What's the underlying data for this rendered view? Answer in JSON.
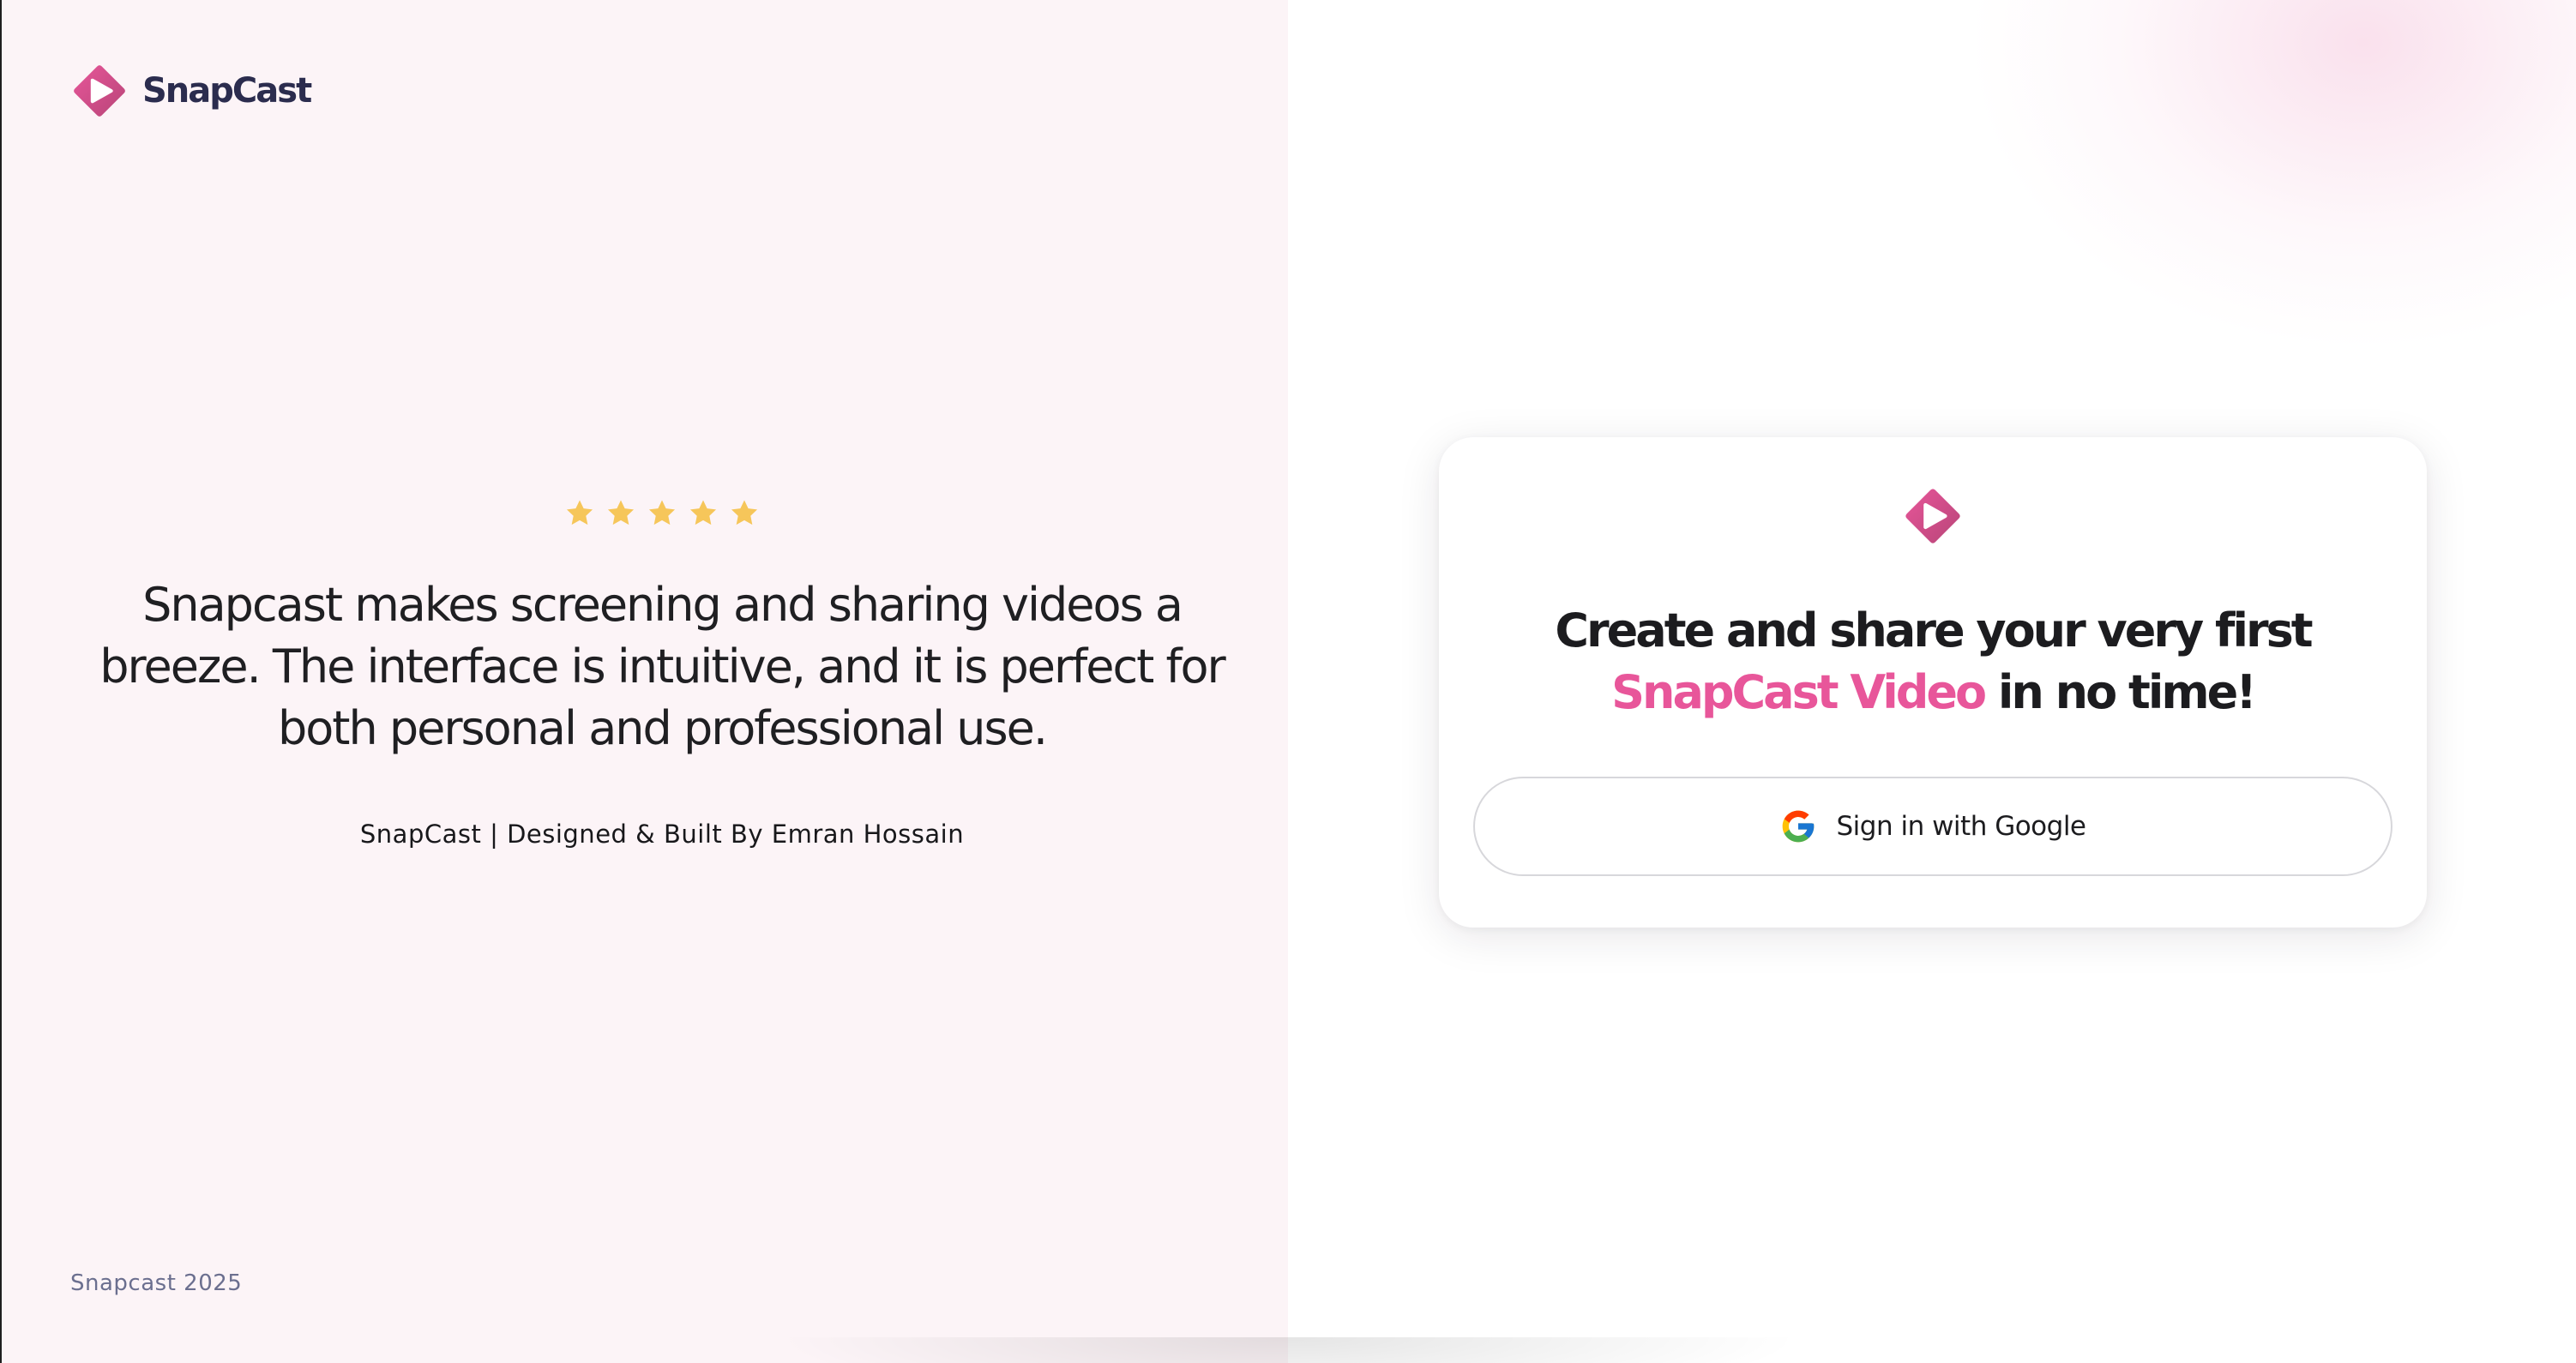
{
  "brand": {
    "name": "SnapCast",
    "logo_icon": "snapcast-play-logo-icon",
    "color_dark": "#c04a7e",
    "color_light": "#e8569a"
  },
  "testimonial": {
    "rating": 5,
    "rating_max": 5,
    "star_icon": "star-icon",
    "star_color": "#f6c65a",
    "quote": "Snapcast makes screening and sharing videos a breeze. The interface is intuitive, and it is perfect for both personal and professional use.",
    "credit": "SnapCast | Designed & Built By Emran Hossain"
  },
  "footer": {
    "copyright": "Snapcast 2025"
  },
  "signin_card": {
    "title_part1": "Create and share your very first ",
    "title_highlight": "SnapCast Video",
    "title_part2": " in no time!",
    "accent_color": "#e8569a",
    "google_button": {
      "label": "Sign in with Google",
      "icon": "google-g-icon"
    }
  }
}
